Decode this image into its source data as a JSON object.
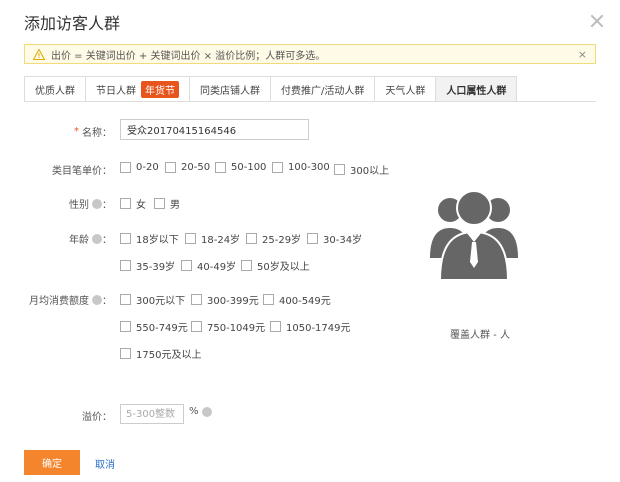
{
  "dialog": {
    "title": "添加访客人群",
    "close_icon": "close-icon"
  },
  "notice": {
    "text": "出价 = 关键词出价 + 关键词出价 × 溢价比例；人群可多选。",
    "close": "×"
  },
  "tabs": [
    {
      "label": "优质人群",
      "active": false
    },
    {
      "label": "节日人群",
      "badge": "年货节",
      "active": false
    },
    {
      "label": "同类店铺人群",
      "active": false
    },
    {
      "label": "付费推广/活动人群",
      "active": false
    },
    {
      "label": "天气人群",
      "active": false
    },
    {
      "label": "人口属性人群",
      "active": true
    }
  ],
  "name_field": {
    "required": "*",
    "label": "名称：",
    "value": "受众20170415164546"
  },
  "price": {
    "label": "类目笔单价：",
    "options": [
      "0-20",
      "20-50",
      "50-100",
      "100-300",
      "300以上"
    ]
  },
  "gender": {
    "label": "性别",
    "colon": "：",
    "options": [
      "女",
      "男"
    ]
  },
  "age": {
    "label": "年龄",
    "colon": "：",
    "options": [
      "18岁以下",
      "18-24岁",
      "25-29岁",
      "30-34岁",
      "35-39岁",
      "40-49岁",
      "50岁及以上"
    ]
  },
  "spend": {
    "label": "月均消费额度",
    "colon": "：",
    "options": [
      "300元以下",
      "300-399元",
      "400-549元",
      "550-749元",
      "750-1049元",
      "1050-1749元",
      "1750元及以上"
    ]
  },
  "coverage": {
    "text": "覆盖人群 - 人"
  },
  "premium": {
    "label": "溢价：",
    "placeholder": "5-300整数",
    "unit": "%"
  },
  "actions": {
    "ok": "确定",
    "cancel": "取消"
  },
  "colors": {
    "accent": "#f5852c",
    "badge": "#e8541e",
    "link": "#2b6dc7",
    "avatar": "#666666"
  }
}
